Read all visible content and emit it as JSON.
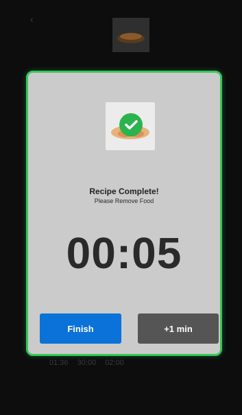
{
  "background": {
    "back_icon": "back-arrow-icon",
    "recipe_title": "",
    "times": [
      "01:36",
      "30:00",
      "02:00"
    ]
  },
  "dialog": {
    "title": "Recipe Complete!",
    "subtitle": "Please Remove Food",
    "timer": "00:05",
    "finish_label": "Finish",
    "add_minute_label": "+1 min",
    "check_icon": "check-circle-icon",
    "accent_color": "#34c759"
  },
  "bottom_bar": {
    "items": [
      "",
      "",
      "",
      ""
    ]
  },
  "colors": {
    "finish_button": "#0a72d8",
    "add_minute_button": "#555555",
    "dialog_border": "#34c759"
  }
}
